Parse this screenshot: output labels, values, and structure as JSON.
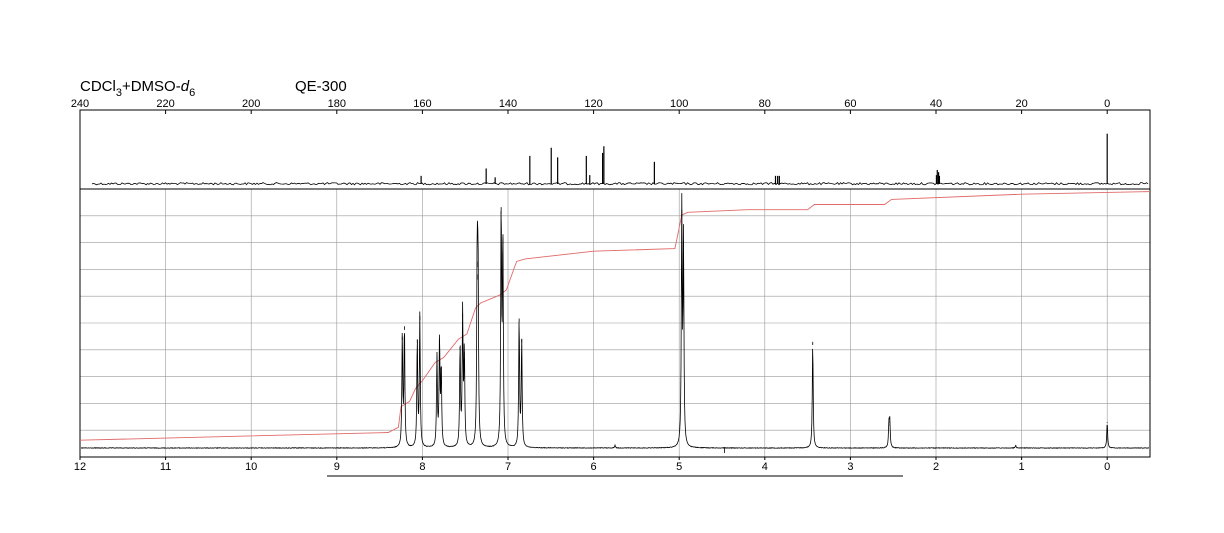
{
  "header": {
    "solvent_main": "CDCl",
    "solvent_sub1": "3",
    "solvent_mid": "+DMSO-",
    "solvent_d": "d",
    "solvent_sub2": "6",
    "instrument": "QE-300"
  },
  "colors": {
    "spectrum": "#000000",
    "integral": "#e06a6a",
    "grid": "#9a9a9a"
  },
  "chart_data": [
    {
      "type": "line",
      "name": "13C spectrum",
      "xlabel": "",
      "ylabel": "",
      "xlim": [
        240,
        -10
      ],
      "x_ticks": [
        240,
        220,
        200,
        180,
        160,
        140,
        120,
        100,
        80,
        60,
        40,
        20,
        0
      ],
      "x_tick_labels": [
        "240",
        "220",
        "200",
        "180",
        "160",
        "140",
        "120",
        "100",
        "80",
        "60",
        "40",
        "20",
        "0"
      ],
      "ylim": [
        0,
        1
      ],
      "grid": false,
      "peaks": [
        {
          "ppm": 160.3,
          "height": 0.11
        },
        {
          "ppm": 145.1,
          "height": 0.21
        },
        {
          "ppm": 143.0,
          "height": 0.09
        },
        {
          "ppm": 134.9,
          "height": 0.38
        },
        {
          "ppm": 129.9,
          "height": 0.49
        },
        {
          "ppm": 128.4,
          "height": 0.36
        },
        {
          "ppm": 121.7,
          "height": 0.38
        },
        {
          "ppm": 120.9,
          "height": 0.12
        },
        {
          "ppm": 117.9,
          "height": 0.42
        },
        {
          "ppm": 117.6,
          "height": 0.51
        },
        {
          "ppm": 105.8,
          "height": 0.3
        },
        {
          "ppm": 77.5,
          "height": 0.11
        },
        {
          "ppm": 77.0,
          "height": 0.11
        },
        {
          "ppm": 76.6,
          "height": 0.11
        },
        {
          "ppm": 39.9,
          "height": 0.12
        },
        {
          "ppm": 39.7,
          "height": 0.19
        },
        {
          "ppm": 39.4,
          "height": 0.16
        },
        {
          "ppm": 39.2,
          "height": 0.11
        },
        {
          "ppm": 0.0,
          "height": 0.68
        }
      ]
    },
    {
      "type": "line",
      "name": "1H spectrum",
      "xlabel": "",
      "ylabel": "",
      "xlim": [
        12,
        -0.5
      ],
      "x_ticks": [
        12,
        11,
        10,
        9,
        8,
        7,
        6,
        5,
        4,
        3,
        2,
        1,
        0
      ],
      "x_tick_labels": [
        "12",
        "11",
        "10",
        "9",
        "8",
        "7",
        "6",
        "5",
        "4",
        "3",
        "2",
        "1",
        "0"
      ],
      "ylim": [
        0,
        1
      ],
      "grid": true,
      "peaks": [
        {
          "ppm": 8.235,
          "height": 0.43
        },
        {
          "ppm": 8.21,
          "height": 0.47
        },
        {
          "ppm": 8.06,
          "height": 0.42
        },
        {
          "ppm": 8.03,
          "height": 0.51
        },
        {
          "ppm": 7.83,
          "height": 0.35
        },
        {
          "ppm": 7.8,
          "height": 0.42
        },
        {
          "ppm": 7.78,
          "height": 0.31
        },
        {
          "ppm": 7.56,
          "height": 0.39
        },
        {
          "ppm": 7.53,
          "height": 0.52
        },
        {
          "ppm": 7.51,
          "height": 0.37
        },
        {
          "ppm": 7.36,
          "height": 0.72
        },
        {
          "ppm": 7.35,
          "height": 0.67
        },
        {
          "ppm": 7.08,
          "height": 0.93
        },
        {
          "ppm": 7.06,
          "height": 0.81
        },
        {
          "ppm": 6.87,
          "height": 0.5
        },
        {
          "ppm": 6.84,
          "height": 0.42
        },
        {
          "ppm": 4.97,
          "height": 0.92
        },
        {
          "ppm": 4.95,
          "height": 0.8
        },
        {
          "ppm": 3.44,
          "height": 0.41
        },
        {
          "ppm": 2.55,
          "height": 0.09
        },
        {
          "ppm": 2.54,
          "height": 0.1
        },
        {
          "ppm": 0.0,
          "height": 0.1
        },
        {
          "ppm": 1.07,
          "height": 0.01
        },
        {
          "ppm": 5.75,
          "height": 0.01
        }
      ],
      "integral_curve": {
        "x": [
          12,
          8.4,
          8.28,
          8.25,
          8.15,
          8.08,
          8.0,
          7.85,
          7.75,
          7.58,
          7.48,
          7.38,
          7.32,
          7.1,
          7.02,
          6.9,
          6.8,
          6.0,
          5.05,
          4.97,
          4.9,
          4.2,
          3.5,
          3.42,
          3.0,
          2.6,
          2.52,
          1.0,
          -0.5
        ],
        "y": [
          0.03,
          0.06,
          0.08,
          0.16,
          0.18,
          0.23,
          0.26,
          0.33,
          0.35,
          0.42,
          0.44,
          0.54,
          0.56,
          0.59,
          0.61,
          0.72,
          0.73,
          0.76,
          0.77,
          0.9,
          0.91,
          0.92,
          0.92,
          0.94,
          0.94,
          0.94,
          0.96,
          0.98,
          0.99
        ]
      }
    }
  ]
}
